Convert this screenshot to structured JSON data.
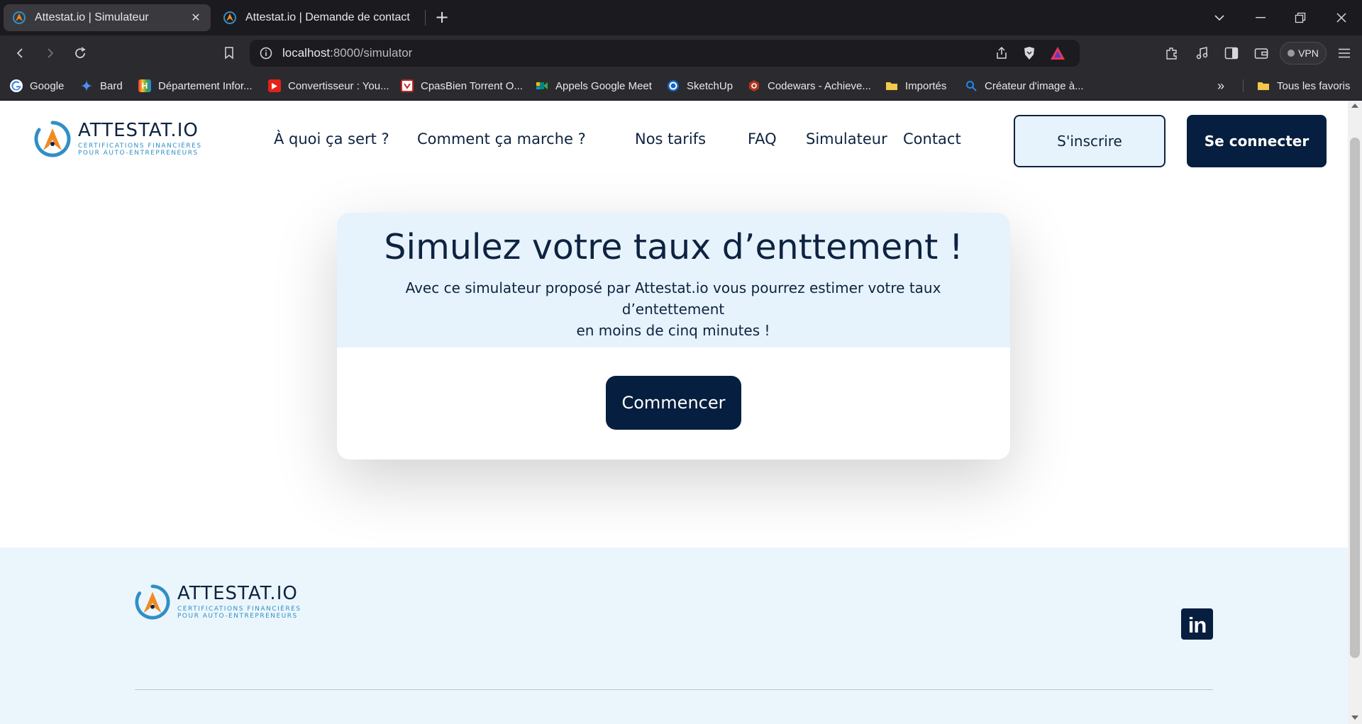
{
  "browser": {
    "tabs": [
      {
        "title": "Attestat.io | Simulateur",
        "close": "✕"
      },
      {
        "title": "Attestat.io | Demande de contact"
      }
    ],
    "new_tab": "+",
    "url_host": "localhost",
    "url_path": ":8000/simulator",
    "vpn_label": "VPN",
    "bookmarks": [
      {
        "label": "Google",
        "icon": "google-icon",
        "color": "#4285f4"
      },
      {
        "label": "Bard",
        "icon": "bard-icon",
        "color": "#4f8df6"
      },
      {
        "label": "Département Infor...",
        "icon": "h-icon",
        "color": "#e53935"
      },
      {
        "label": "Convertisseur : You...",
        "icon": "youtube-icon",
        "color": "#e62117"
      },
      {
        "label": "CpasBien Torrent O...",
        "icon": "cpasbien-icon",
        "color": "#c62828"
      },
      {
        "label": "Appels Google Meet",
        "icon": "meet-icon",
        "color": "#00897b"
      },
      {
        "label": "SketchUp",
        "icon": "sketchup-icon",
        "color": "#1565c0"
      },
      {
        "label": "Codewars - Achieve...",
        "icon": "codewars-icon",
        "color": "#b1361e"
      },
      {
        "label": "Importés",
        "icon": "folder-icon",
        "color": "#f2c94c"
      },
      {
        "label": "Créateur d'image à...",
        "icon": "bing-icon",
        "color": "#1e88e5"
      }
    ],
    "more_bookmarks": "»",
    "all_favorites": "Tous les favoris"
  },
  "site": {
    "logo_name": "ATTESTAT.IO",
    "logo_sub_1": "CERTIFICATIONS FINANCIÈRES",
    "logo_sub_2": "POUR AUTO-ENTREPRENEURS",
    "nav": [
      "À quoi ça sert ?",
      "Comment ça marche ?",
      "Nos tarifs",
      "FAQ",
      "Simulateur",
      "Contact"
    ],
    "signup_label": "S'inscrire",
    "login_label": "Se connecter",
    "card": {
      "title": "Simulez votre taux d’enttement !",
      "desc_line1": "Avec ce simulateur proposé par Attestat.io vous pourrez estimer votre taux d’entettement",
      "desc_line2": "en moins de cinq minutes !",
      "start_label": "Commencer"
    },
    "footer": {
      "linkedin_label": "in"
    }
  },
  "colors": {
    "navy": "#0e2340",
    "accent_blue": "#2f8fc7",
    "accent_orange": "#f08a24",
    "light_blue_bg": "#e6f3fc"
  }
}
